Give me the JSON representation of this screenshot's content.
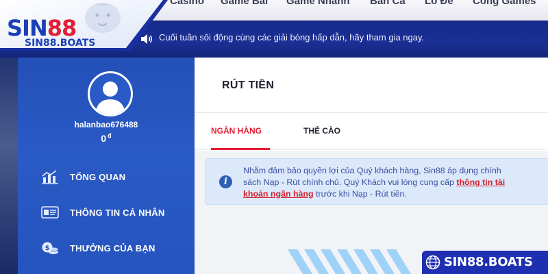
{
  "brand": {
    "logo_prefix": "SIN",
    "logo_number": "88",
    "logo_domain": "SIN88.BOATS",
    "watermark": "SIN88.BOATS",
    "color_primary": "#1b3fb5",
    "color_accent": "#e21f35"
  },
  "topnav": {
    "items": [
      "Casino",
      "Game Bài",
      "Game Nhanh",
      "Bắn Cá",
      "Lô Đề",
      "Cổng Games"
    ]
  },
  "announcement": {
    "icon": "speaker-icon",
    "text": "Cuối tuần sôi động cùng các giải bóng hấp dẫn, hãy tham gia ngay."
  },
  "user": {
    "username": "halanbao676488",
    "balance": "0",
    "currency": "đ"
  },
  "sidebar": {
    "items": [
      {
        "label": "TỔNG QUAN",
        "icon": "chart-icon"
      },
      {
        "label": "THÔNG TIN CÁ NHÂN",
        "icon": "id-card-icon"
      },
      {
        "label": "THƯỞNG CỦA BẠN",
        "icon": "coins-icon"
      }
    ]
  },
  "main": {
    "title": "RÚT TIỀN",
    "tabs": [
      {
        "label": "NGÂN HÀNG",
        "active": true
      },
      {
        "label": "THẺ CÀO",
        "active": false
      }
    ],
    "notice": {
      "line1": "Nhằm đảm bảo quyền lợi của Quý khách hàng, Sin88 áp dụng chính",
      "line2_pre": "sách Nạp - Rút chính chủ. Quý Khách vui lòng cung cấp ",
      "link_part1": "thông tin tài",
      "link_part2": "khoản ngân hàng",
      "line3_post": " trước khi Nạp - Rút tiền."
    }
  }
}
